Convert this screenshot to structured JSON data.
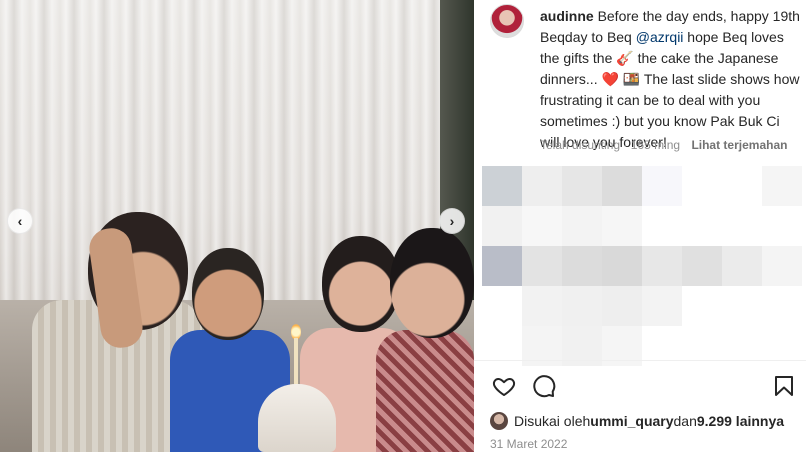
{
  "post": {
    "username": "audinne",
    "caption_before_mention": "Before the day ends, happy 19th Beqday to Beq ",
    "mention": "@azrqii",
    "caption_after_mention": " hope Beq loves the gifts the 🎸 the cake the Japanese dinners... ❤️ 🍱 The last slide shows how frustrating it can be to deal with you sometimes :) but you know Pak Buk Ci will love you forever!",
    "edited_label": "Telah disunting · 165 ming",
    "translate_label": "Lihat terjemahan"
  },
  "actions": {
    "like_icon": "heart-icon",
    "comment_icon": "comment-icon",
    "save_icon": "bookmark-icon"
  },
  "likes": {
    "prefix": "Disukai oleh ",
    "first_user": "ummi_quary",
    "middle": " dan ",
    "count_text": "9.299 lainnya"
  },
  "date": "31 Maret 2022",
  "carousel": {
    "prev_icon": "chevron-left-icon",
    "next_icon": "chevron-right-icon",
    "prev_glyph": "‹",
    "next_glyph": "›"
  },
  "colors": {
    "text": "#262626",
    "muted": "#8e8e8e",
    "link": "#00376b"
  }
}
